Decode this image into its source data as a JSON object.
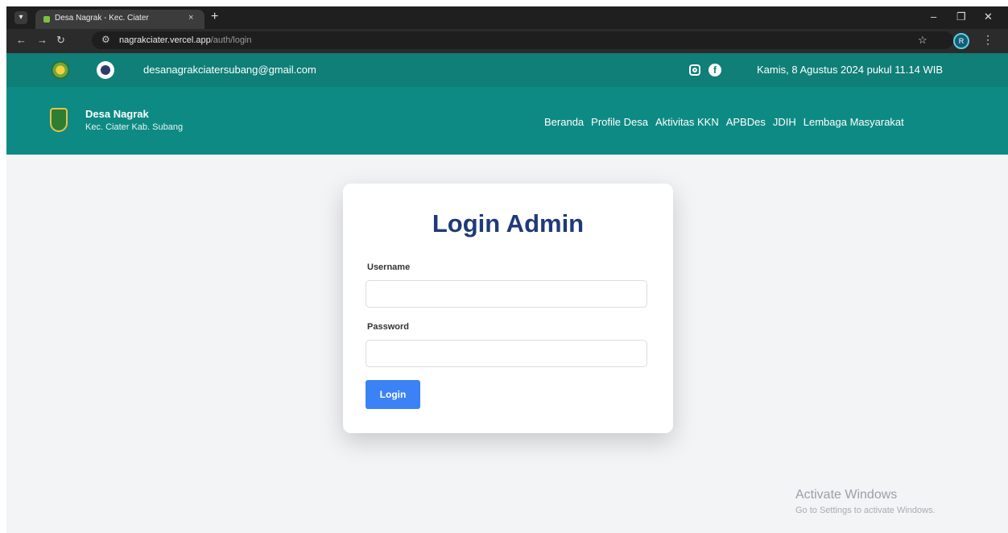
{
  "browser": {
    "tab_title": "Desa Nagrak - Kec. Ciater",
    "tab_close": "×",
    "new_tab": "+",
    "url_host": "nagrakciater.vercel.app",
    "url_path": "/auth/login",
    "profile_initial": "R",
    "window_controls": [
      "–",
      "❐",
      "✕"
    ],
    "icons": [
      "tab-search-icon",
      "back-icon",
      "forward-icon",
      "reload-icon",
      "site-info-icon",
      "bookmark-star-icon",
      "kebab-menu-icon"
    ]
  },
  "topbar": {
    "email": "desanagrakciatersubang@gmail.com",
    "datetime": "Kamis, 8 Agustus 2024 pukul 11.14 WIB",
    "icons": [
      "instagram-icon",
      "facebook-icon"
    ]
  },
  "header": {
    "site_name": "Desa Nagrak",
    "site_sub": "Kec. Ciater Kab. Subang",
    "nav": [
      "Beranda",
      "Profile Desa",
      "Aktivitas KKN",
      "APBDes",
      "JDIH",
      "Lembaga Masyarakat"
    ]
  },
  "login": {
    "title": "Login Admin",
    "username_label": "Username",
    "username_value": "",
    "password_label": "Password",
    "password_value": "",
    "button_label": "Login"
  },
  "watermark": {
    "title": "Activate Windows",
    "subtitle": "Go to Settings to activate Windows."
  },
  "colors": {
    "teal_topbar": "#0f7f78",
    "teal_nav": "#0e8a84",
    "title_blue": "#1f3a7a",
    "button_blue": "#3b82f6"
  }
}
